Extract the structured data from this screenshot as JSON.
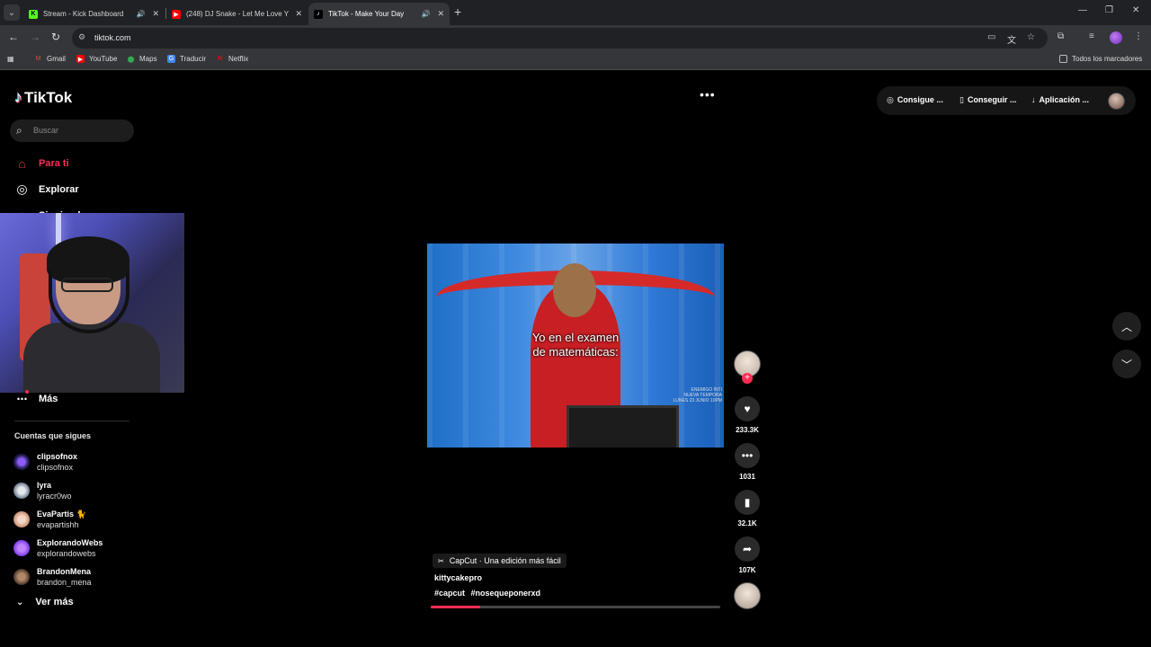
{
  "browser": {
    "tabs": [
      {
        "title": "Stream - Kick Dashboard",
        "favicon": "kick-icon",
        "audio": true
      },
      {
        "title": "(248) DJ Snake - Let Me Love Y",
        "favicon": "youtube-icon",
        "audio": false
      },
      {
        "title": "TikTok - Make Your Day",
        "favicon": "tiktok-icon",
        "audio": true,
        "active": true
      }
    ],
    "url": "tiktok.com",
    "bookmarks": [
      {
        "label": "Gmail",
        "icon": "gmail-icon"
      },
      {
        "label": "YouTube",
        "icon": "youtube-icon"
      },
      {
        "label": "Maps",
        "icon": "maps-icon"
      },
      {
        "label": "Traducir",
        "icon": "translate-icon"
      },
      {
        "label": "Netflix",
        "icon": "netflix-icon"
      }
    ],
    "all_bookmarks": "Todos los marcadores"
  },
  "tiktok": {
    "logo": "TikTok",
    "search_placeholder": "Buscar",
    "nav": {
      "for_you": "Para ti",
      "explore": "Explorar",
      "following": "Siguiendo",
      "more": "Más"
    },
    "following_title": "Cuentas que sigues",
    "accounts": [
      {
        "name": "clipsofnox",
        "handle": "clipsofnox"
      },
      {
        "name": "lyra",
        "handle": "lyracr0wo"
      },
      {
        "name": "EvaPartis",
        "handle": "evapartishh"
      },
      {
        "name": "ExplorandoWebs",
        "handle": "explorandowebs"
      },
      {
        "name": "BrandonMena",
        "handle": "brandon_mena"
      }
    ],
    "see_more": "Ver más",
    "header": {
      "coins": "Consigue ...",
      "app": "Conseguir ...",
      "download": "Aplicación ..."
    },
    "video": {
      "caption_line1": "Yo en el examen",
      "caption_line2": "de matemáticas:",
      "watermark": "ENEMIGO ÍNTI\nNUEVA TEMPORA\nLUNES 23 JUNIO 10PM",
      "capcut_label": "CapCut · Una edición más fácil",
      "author": "kittycakepro",
      "hashtags": [
        "#capcut",
        "#nosequeponerxd"
      ],
      "progress": 0.17
    },
    "actions": {
      "likes": "233.3K",
      "comments": "1031",
      "saves": "32.1K",
      "shares": "107K"
    }
  },
  "colors": {
    "accent": "#fe2c55",
    "chrome_dark": "#202124",
    "chrome_mid": "#35363a"
  }
}
